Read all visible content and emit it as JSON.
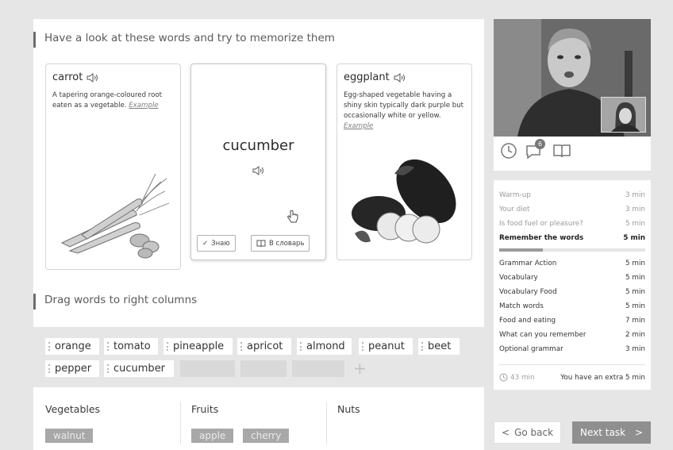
{
  "lesson": {
    "memorize_title": "Have a look at these words and try to memorize them",
    "drag_title": "Drag words to right columns"
  },
  "cards": {
    "left": {
      "word": "carrot",
      "description": "A tapering orange-coloured root eaten as a vegetable.",
      "example_label": "Example"
    },
    "center": {
      "word": "cucumber",
      "know_label": "Знаю",
      "dictionary_label": "В словарь"
    },
    "right": {
      "word": "eggplant",
      "description": "Egg-shaped vegetable having a shiny skin typically dark purple but occasionally white or yellow.",
      "example_label": "Example"
    }
  },
  "word_pool": {
    "row1": [
      "orange",
      "tomato",
      "pineapple",
      "apricot",
      "almond",
      "peanut",
      "beet"
    ],
    "row2": [
      "pepper",
      "cucumber"
    ]
  },
  "columns": {
    "vegetables": {
      "title": "Vegetables",
      "words": [
        "walnut"
      ]
    },
    "fruits": {
      "title": "Fruits",
      "words": [
        "apple",
        "cherry"
      ]
    },
    "nuts": {
      "title": "Nuts",
      "words": []
    }
  },
  "video": {
    "chat_badge": "6",
    "icons": [
      "clock-icon",
      "chat-icon",
      "book-icon"
    ]
  },
  "plan": {
    "items": [
      {
        "label": "Warm-up",
        "time": "3 min",
        "state": "done"
      },
      {
        "label": "Your diet",
        "time": "3 min",
        "state": "done"
      },
      {
        "label": "Is food fuel or pleasure?",
        "time": "5 min",
        "state": "done"
      },
      {
        "label": "Remember the words",
        "time": "5 min",
        "state": "current"
      },
      {
        "label": "Grammar Action",
        "time": "5 min",
        "state": "todo"
      },
      {
        "label": "Vocabulary",
        "time": "5 min",
        "state": "todo"
      },
      {
        "label": "Vocabulary Food",
        "time": "5 min",
        "state": "todo"
      },
      {
        "label": "Match words",
        "time": "5 min",
        "state": "todo"
      },
      {
        "label": "Food and eating",
        "time": "7 min",
        "state": "todo"
      },
      {
        "label": "What can you remember",
        "time": "2 min",
        "state": "todo"
      },
      {
        "label": "Optional grammar",
        "time": "3 min",
        "state": "todo"
      }
    ],
    "current_progress": 0.3,
    "total_time": "43 min",
    "extra_note": "You have an extra 5 min"
  },
  "nav": {
    "back_label": "Go back",
    "next_label": "Next task"
  },
  "colors": {
    "background": "#e6e6e6",
    "panel": "#ffffff",
    "next_button": "#8f8f8f",
    "placed_chip": "#a8a8a8"
  }
}
